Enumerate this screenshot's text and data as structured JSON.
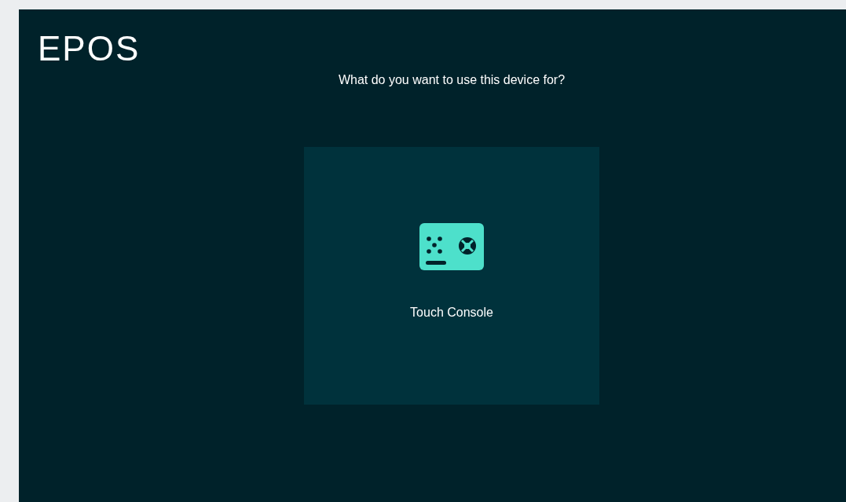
{
  "logo": "EPOS",
  "question": "What do you want to use this device for?",
  "options": [
    {
      "label": "Touch Console"
    }
  ]
}
